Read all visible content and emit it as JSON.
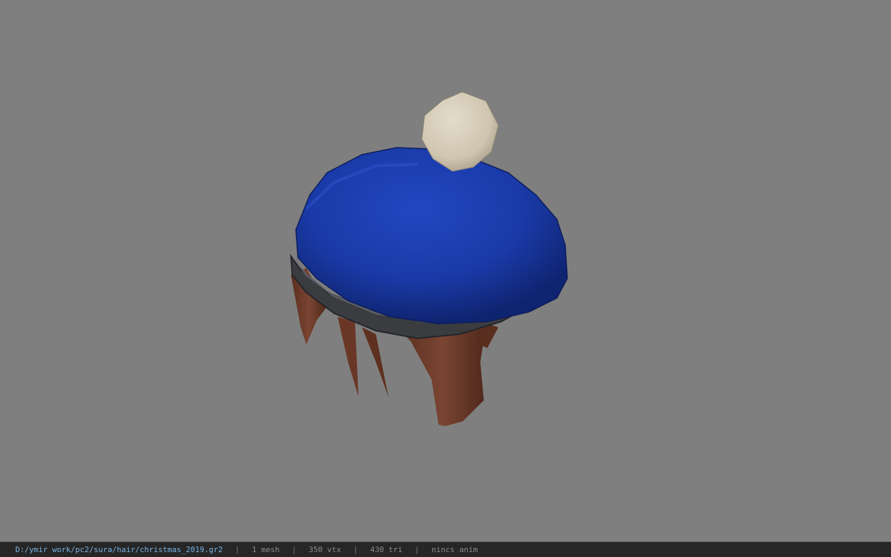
{
  "viewer": {
    "background_color": "#7f7f7f",
    "model": {
      "description_icon": "beret-hat-model",
      "hat_color": "#1a3aa8",
      "band_color": "#3a3c40",
      "pompom_color": "#d6cdb8",
      "hair_color": "#6b3a28"
    }
  },
  "status_bar": {
    "file_path": "D:/ymir work/pc2/sura/hair/christmas_2019.gr2",
    "separator": "|",
    "mesh_count": "1 mesh",
    "vertex_count": "350 vtx",
    "triangle_count": "430 tri",
    "animation": "nincs anim",
    "path_color": "#78b4e6",
    "text_color": "#8c8c8c"
  }
}
